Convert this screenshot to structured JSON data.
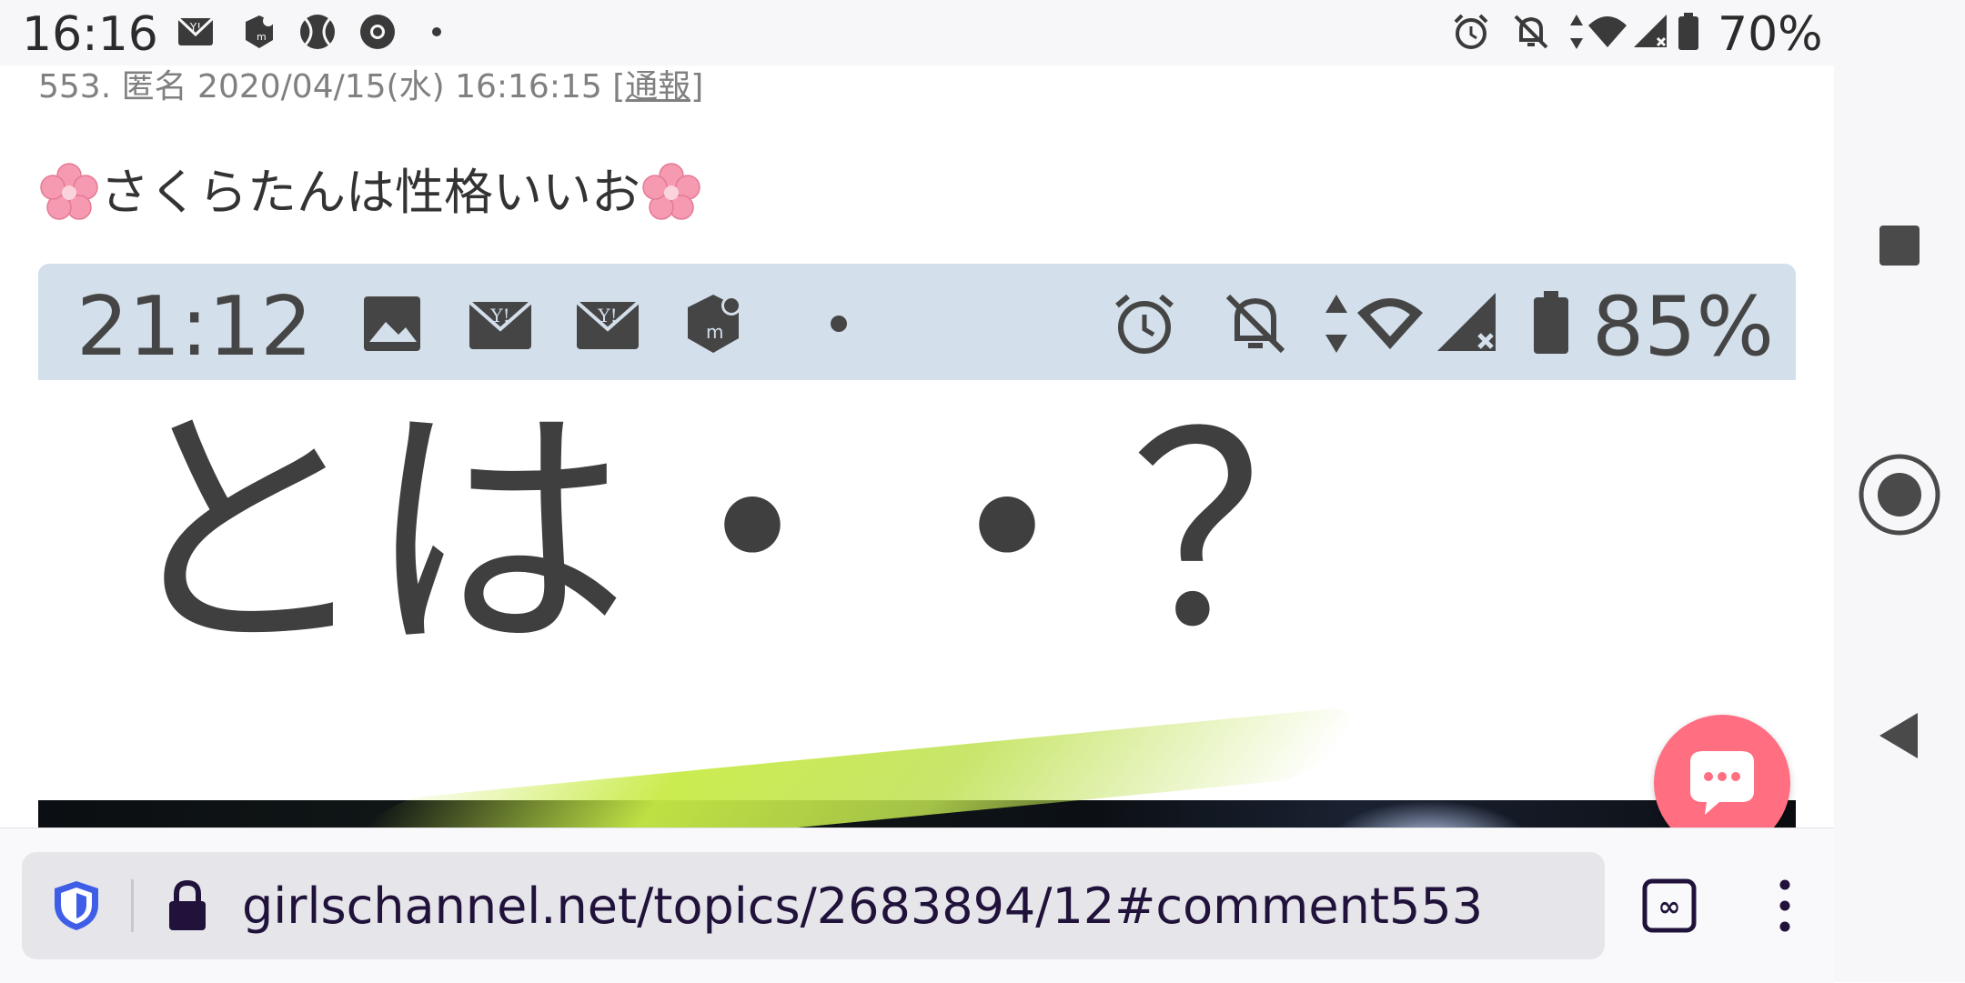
{
  "status_bar": {
    "time": "16:16",
    "battery_percent": "70%",
    "left_icons": [
      "yahoo-mail-icon",
      "mercari-icon",
      "tennis-ball-icon",
      "chrome-icon",
      "dot-icon"
    ],
    "right_icons": [
      "alarm-icon",
      "notifications-off-icon",
      "data-arrows-icon",
      "wifi-icon",
      "signal-icon",
      "battery-icon"
    ]
  },
  "comment": {
    "meta": "553. 匿名 2020/04/15(水) 16:16:15",
    "report_label": "[通報]",
    "text": "さくらたんは性格いいお"
  },
  "embedded_image": {
    "time": "21:12",
    "battery_percent": "85%",
    "big_text": "とは・・？"
  },
  "browser": {
    "url": "girlschannel.net/topics/2683894/12#comment553"
  },
  "colors": {
    "fab": "#ff6f81",
    "url_text": "#20123a",
    "inner_status_bg": "#d3dfea"
  }
}
